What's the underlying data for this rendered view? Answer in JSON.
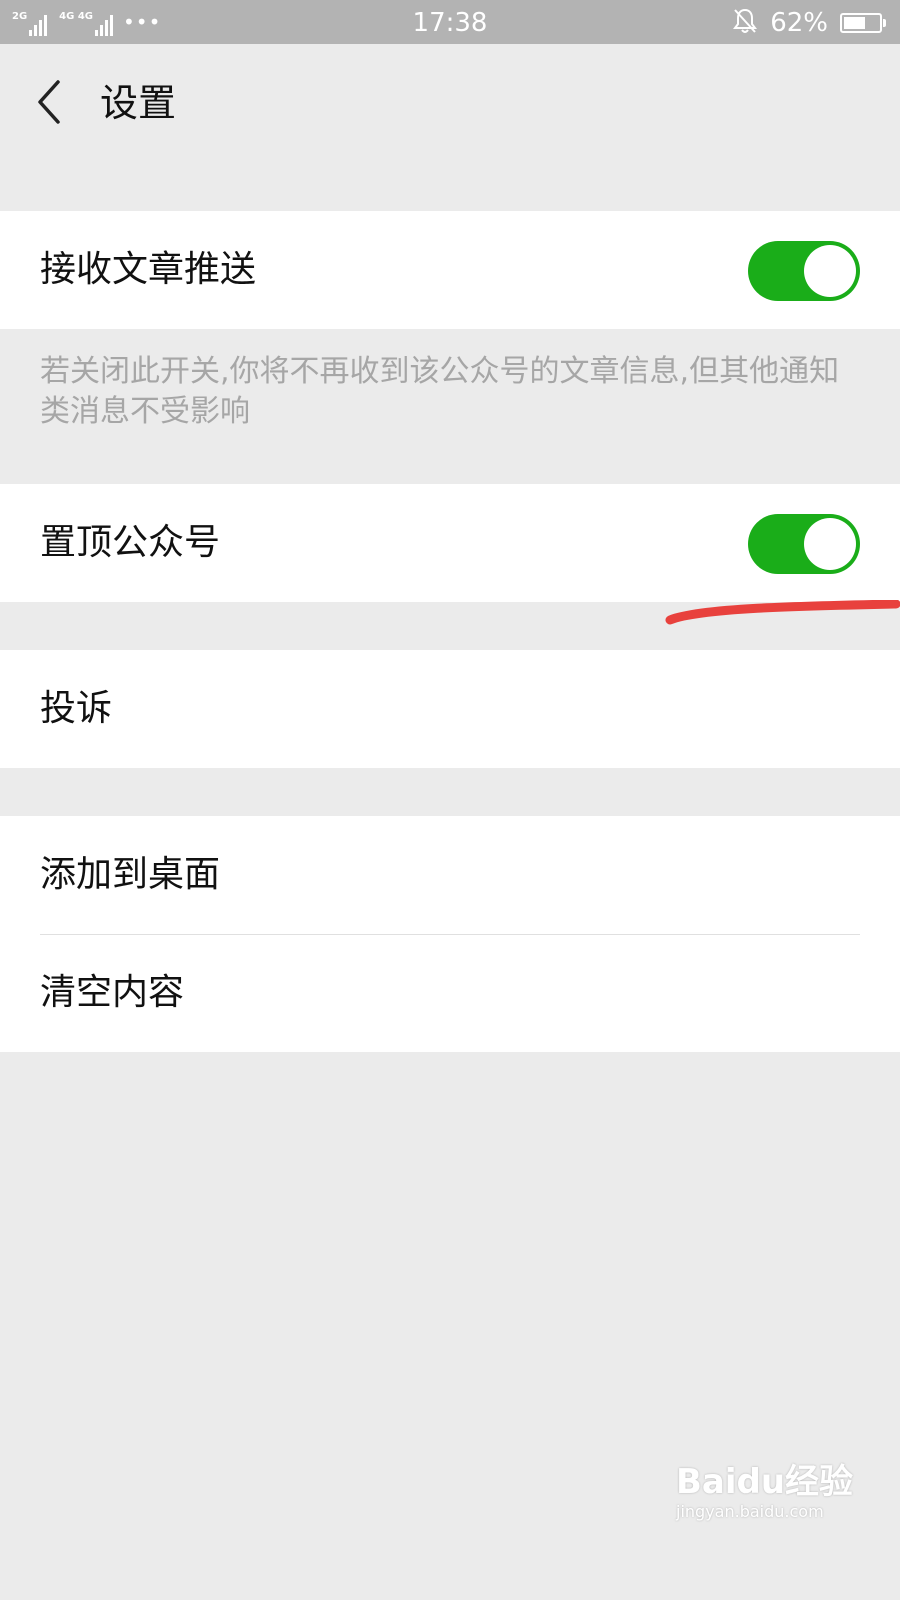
{
  "status_bar": {
    "network_left": "2G",
    "network_right": "4G 4G",
    "more": "•••",
    "time": "17:38",
    "battery_percent": "62%",
    "battery_level": 0.62,
    "icons": [
      "signal-icon",
      "bell-off-icon",
      "battery-icon"
    ]
  },
  "header": {
    "title": "设置",
    "back_icon": "chevron-left-icon"
  },
  "settings": {
    "receive_articles": {
      "label": "接收文章推送",
      "enabled": true,
      "description": "若关闭此开关,你将不再收到该公众号的文章信息,但其他通知类消息不受影响"
    },
    "pin_account": {
      "label": "置顶公众号",
      "enabled": true
    },
    "complain": {
      "label": "投诉"
    },
    "add_to_desktop": {
      "label": "添加到桌面"
    },
    "clear_content": {
      "label": "清空内容"
    }
  },
  "colors": {
    "toggle_on": "#1aad19",
    "background": "#ebebeb",
    "annotation": "#e8413d"
  },
  "watermark": {
    "logo": "Baidu经验",
    "url": "jingyan.baidu.com"
  }
}
